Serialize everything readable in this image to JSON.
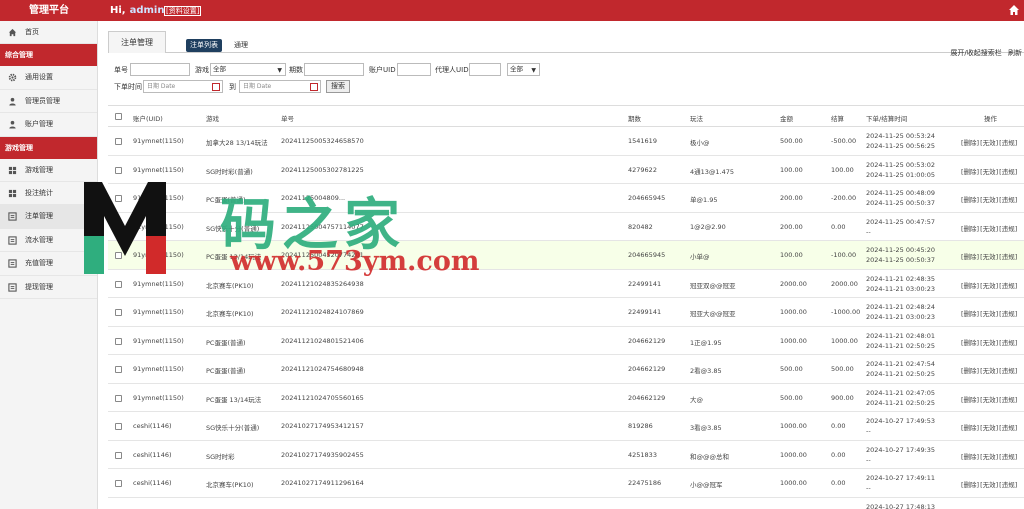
{
  "topbar": {
    "brand": "管理平台",
    "greeting": "Hi,",
    "username": "admin",
    "profile_link": "[资料设置]"
  },
  "sidebar": {
    "items": [
      {
        "label": "首页",
        "icon": "home-icon"
      },
      {
        "group": "综合管理"
      },
      {
        "label": "通用设置",
        "icon": "gear-icon"
      },
      {
        "label": "管理员管理",
        "icon": "user-icon"
      },
      {
        "label": "账户管理",
        "icon": "user-icon"
      },
      {
        "group": "游戏管理"
      },
      {
        "label": "游戏管理",
        "icon": "grid-icon"
      },
      {
        "label": "投注统计",
        "icon": "grid-icon"
      },
      {
        "label": "注单管理",
        "icon": "list-icon"
      },
      {
        "label": "流水管理",
        "icon": "list-icon"
      },
      {
        "label": "充值管理",
        "icon": "list-icon"
      },
      {
        "label": "提现管理",
        "icon": "list-icon"
      }
    ]
  },
  "page": {
    "title": "注单管理",
    "tab_active": "注单列表",
    "tab_other": "通理",
    "tool_expand": "展开/收起搜索栏",
    "tool_refresh": "刷新"
  },
  "filters": {
    "order_no_label": "单号",
    "game_label": "游戏",
    "game_value": "全部",
    "period_label": "期数",
    "account_uid_label": "账户UID",
    "agent_uid_label": "代理人UID",
    "status_value": "全部",
    "time_label": "下单时间",
    "date_placeholder": "日期 Date",
    "to_label": "到",
    "search_btn": "搜索"
  },
  "table": {
    "headers": [
      "账户(UID)",
      "游戏",
      "单号",
      "期数",
      "玩法",
      "金额",
      "结算",
      "下单/结算时间",
      "操作"
    ],
    "ops": [
      "[删除]",
      "[无效]",
      "[违规]"
    ],
    "rows": [
      {
        "account": "91ymnet(1150)",
        "game": "加拿大28 13/14玩法",
        "order": "20241125005324658570",
        "period": "1541619",
        "play": "极小@",
        "amount": "500.00",
        "settle": "-500.00",
        "t1": "2024-11-25 00:53:24",
        "t2": "2024-11-25 00:56:25"
      },
      {
        "account": "91ymnet(1150)",
        "game": "SG时时彩(普通)",
        "order": "20241125005302781225",
        "period": "4279622",
        "play": "4通13@1.475",
        "amount": "100.00",
        "settle": "100.00",
        "t1": "2024-11-25 00:53:02",
        "t2": "2024-11-25 01:00:05"
      },
      {
        "account": "91ymnet(1150)",
        "game": "PC蛋蛋(普通)",
        "order": "20241125004809...",
        "period": "204665945",
        "play": "单@1.95",
        "amount": "200.00",
        "settle": "-200.00",
        "t1": "2024-11-25 00:48:09",
        "t2": "2024-11-25 00:50:37"
      },
      {
        "account": "91ymnet(1150)",
        "game": "SG快乐十分(普通)",
        "order": "20241125004757114077",
        "period": "820482",
        "play": "1@2@2.90",
        "amount": "200.00",
        "settle": "0.00",
        "t1": "2024-11-25 00:47:57",
        "t2": "--"
      },
      {
        "account": "91ymnet(1150)",
        "game": "PC蛋蛋 13/14玩法",
        "order": "20241125004520774201",
        "period": "204665945",
        "play": "小单@",
        "amount": "100.00",
        "settle": "-100.00",
        "t1": "2024-11-25 00:45:20",
        "t2": "2024-11-25 00:50:37"
      },
      {
        "account": "91ymnet(1150)",
        "game": "北京赛车(PK10)",
        "order": "20241121024835264938",
        "period": "22499141",
        "play": "冠亚双@@冠亚",
        "amount": "2000.00",
        "settle": "2000.00",
        "t1": "2024-11-21 02:48:35",
        "t2": "2024-11-21 03:00:23"
      },
      {
        "account": "91ymnet(1150)",
        "game": "北京赛车(PK10)",
        "order": "20241121024824107869",
        "period": "22499141",
        "play": "冠亚大@@冠亚",
        "amount": "1000.00",
        "settle": "-1000.00",
        "t1": "2024-11-21 02:48:24",
        "t2": "2024-11-21 03:00:23"
      },
      {
        "account": "91ymnet(1150)",
        "game": "PC蛋蛋(普通)",
        "order": "20241121024801521406",
        "period": "204662129",
        "play": "1正@1.95",
        "amount": "1000.00",
        "settle": "1000.00",
        "t1": "2024-11-21 02:48:01",
        "t2": "2024-11-21 02:50:25"
      },
      {
        "account": "91ymnet(1150)",
        "game": "PC蛋蛋(普通)",
        "order": "20241121024754680948",
        "period": "204662129",
        "play": "2看@3.85",
        "amount": "500.00",
        "settle": "500.00",
        "t1": "2024-11-21 02:47:54",
        "t2": "2024-11-21 02:50:25"
      },
      {
        "account": "91ymnet(1150)",
        "game": "PC蛋蛋 13/14玩法",
        "order": "20241121024705560165",
        "period": "204662129",
        "play": "大@",
        "amount": "500.00",
        "settle": "900.00",
        "t1": "2024-11-21 02:47:05",
        "t2": "2024-11-21 02:50:25"
      },
      {
        "account": "ceshi(1146)",
        "game": "SG快乐十分(普通)",
        "order": "20241027174953412157",
        "period": "819286",
        "play": "3看@3.85",
        "amount": "1000.00",
        "settle": "0.00",
        "t1": "2024-10-27 17:49:53",
        "t2": "--"
      },
      {
        "account": "ceshi(1146)",
        "game": "SG时时彩",
        "order": "20241027174935902455",
        "period": "4251833",
        "play": "和@@@总和",
        "amount": "1000.00",
        "settle": "0.00",
        "t1": "2024-10-27 17:49:35",
        "t2": "--"
      },
      {
        "account": "ceshi(1146)",
        "game": "北京赛车(PK10)",
        "order": "20241027174911296164",
        "period": "22475186",
        "play": "小@@冠军",
        "amount": "1000.00",
        "settle": "0.00",
        "t1": "2024-10-27 17:49:11",
        "t2": "--"
      },
      {
        "account": "",
        "game": "",
        "order": "",
        "period": "",
        "play": "",
        "amount": "",
        "settle": "",
        "t1": "2024-10-27 17:48:13",
        "t2": ""
      }
    ]
  },
  "watermark": {
    "text": "码之家",
    "url": "www.573ym.com"
  },
  "colors": {
    "brand_red": "#c1282d",
    "tab_active_bg": "#1f3f5f",
    "row_highlight": "#f7ffe8"
  }
}
